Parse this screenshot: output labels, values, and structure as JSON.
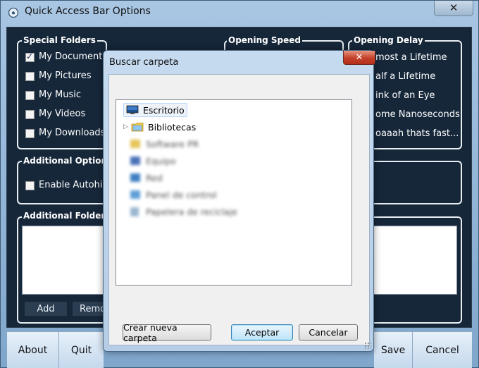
{
  "window": {
    "title": "Quick Access Bar Options",
    "close_glyph": "✕"
  },
  "special_folders": {
    "legend": "Special Folders",
    "items": [
      {
        "label": "My Documents",
        "checked": true
      },
      {
        "label": "My Pictures",
        "checked": false
      },
      {
        "label": "My Music",
        "checked": false
      },
      {
        "label": "My Videos",
        "checked": false
      },
      {
        "label": "My Downloads",
        "checked": false
      }
    ]
  },
  "opening_speed": {
    "legend": "Opening Speed"
  },
  "opening_delay": {
    "legend": "Opening Delay",
    "items": [
      "most a Lifetime",
      "alf a Lifetime",
      "ink of an Eye",
      "ome Nanoseconds",
      "oaaah thats fast..."
    ]
  },
  "additional_options": {
    "legend": "Additional Options",
    "autohide_label": "Enable Autohide"
  },
  "additional_folders": {
    "legend": "Additional Folders",
    "add_label": "Add",
    "remove_label": "Remo"
  },
  "bottom": {
    "about": "About",
    "quit": "Quit",
    "save": "Save",
    "cancel": "Cancel"
  },
  "dialog": {
    "title": "Buscar carpeta",
    "close_glyph": "✕",
    "tree": [
      {
        "label": "Escritorio",
        "selected": true,
        "icon": "desktop-icon"
      },
      {
        "label": "Bibliotecas",
        "selected": false,
        "icon": "libraries-folder-icon",
        "expandable": true
      },
      {
        "label": "Software PR",
        "blurred": true,
        "icon": "user-folder-icon"
      },
      {
        "label": "Equipo",
        "blurred": true,
        "icon": "computer-icon"
      },
      {
        "label": "Red",
        "blurred": true,
        "icon": "network-icon"
      },
      {
        "label": "Panel de control",
        "blurred": true,
        "icon": "control-panel-icon"
      },
      {
        "label": "Papelera de reciclaje",
        "blurred": true,
        "icon": "recycle-bin-icon"
      }
    ],
    "new_folder": "Crear nueva carpeta",
    "accept": "Aceptar",
    "cancel": "Cancelar"
  },
  "colors": {
    "client_bg": "#16273a",
    "frame": "#a9c6e3",
    "close_red": "#c2402a"
  }
}
